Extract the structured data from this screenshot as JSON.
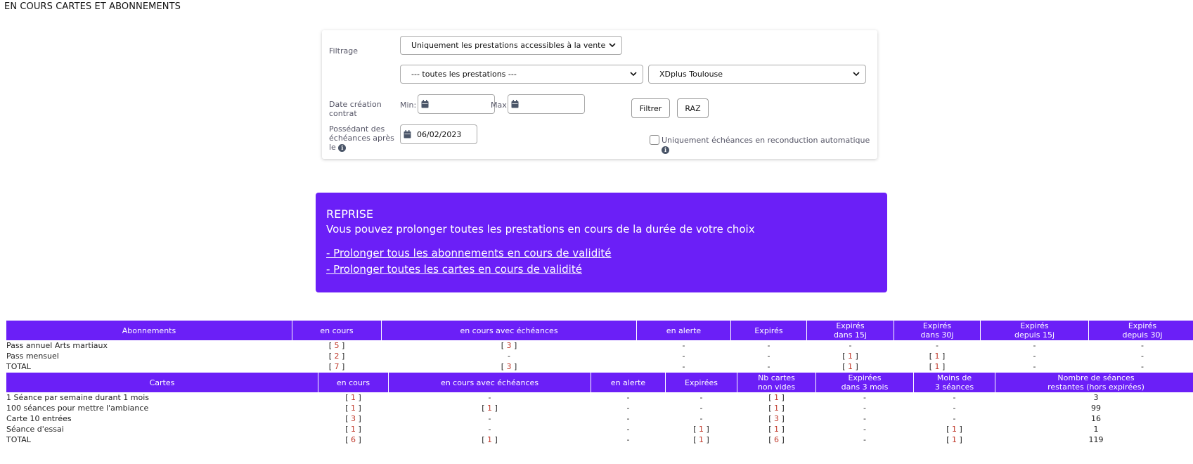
{
  "page_title": "EN COURS CARTES ET ABONNEMENTS",
  "filter": {
    "filtrage_label": "Filtrage",
    "select_vente": "Uniquement les prestations accessibles à la vente",
    "select_prestations": "--- toutes les prestations ---",
    "select_club": "XDplus Toulouse",
    "date_creation_label_1": "Date création",
    "date_creation_label_2": "contrat",
    "min_label": "Min:",
    "max_label": "Max:",
    "min_value": "",
    "max_value": "",
    "filtrer_label": "Filtrer",
    "raz_label": "RAZ",
    "echeances_label_1": "Possédant des",
    "echeances_label_2": "échéances après",
    "echeances_label_3": "le",
    "echeances_date": "06/02/2023",
    "reconduction_label": "Uniquement échéances en reconduction automatique"
  },
  "reprise": {
    "title": "REPRISE",
    "text": "Vous pouvez prolonger toutes les prestations en cours de la durée de votre choix",
    "link_abonnements": "- Prolonger tous les abonnements en cours de validité",
    "link_cartes": "- Prolonger toutes les cartes en cours de validité"
  },
  "abonnements": {
    "headers": [
      "Abonnements",
      "en cours",
      "en cours avec échéances",
      "en alerte",
      "Expirés",
      "Expirés\ndans 15j",
      "Expirés\ndans 30j",
      "Expirés\ndepuis 15j",
      "Expirés\ndepuis 30j"
    ],
    "rows": [
      [
        "Pass annuel Arts martiaux",
        "[5]",
        "[3]",
        "-",
        "-",
        "-",
        "-",
        "-",
        "-"
      ],
      [
        "Pass mensuel",
        "[2]",
        "-",
        "-",
        "-",
        "[1]",
        "[1]",
        "-",
        "-"
      ],
      [
        "TOTAL",
        "[7]",
        "[3]",
        "-",
        "-",
        "[1]",
        "[1]",
        "-",
        "-"
      ]
    ]
  },
  "cartes": {
    "headers": [
      "Cartes",
      "en cours",
      "en cours avec échéances",
      "en alerte",
      "Expirées",
      "Nb cartes\nnon vides",
      "Expirées\ndans 3 mois",
      "Moins de\n3 séances",
      "Nombre de séances\nrestantes (hors expirées)"
    ],
    "rows": [
      [
        "1 Séance par semaine durant 1 mois",
        "[1]",
        "-",
        "-",
        "-",
        "[1]",
        "-",
        "-",
        "3"
      ],
      [
        "100 séances pour mettre l'ambiance",
        "[1]",
        "[1]",
        "-",
        "-",
        "[1]",
        "-",
        "-",
        "99"
      ],
      [
        "Carte 10 entrées",
        "[3]",
        "-",
        "-",
        "-",
        "[3]",
        "-",
        "-",
        "16"
      ],
      [
        "Séance d'essai",
        "[1]",
        "-",
        "-",
        "[1]",
        "[1]",
        "-",
        "[1]",
        "1"
      ],
      [
        "TOTAL",
        "[6]",
        "[1]",
        "-",
        "[1]",
        "[6]",
        "-",
        "[1]",
        "119"
      ]
    ]
  }
}
